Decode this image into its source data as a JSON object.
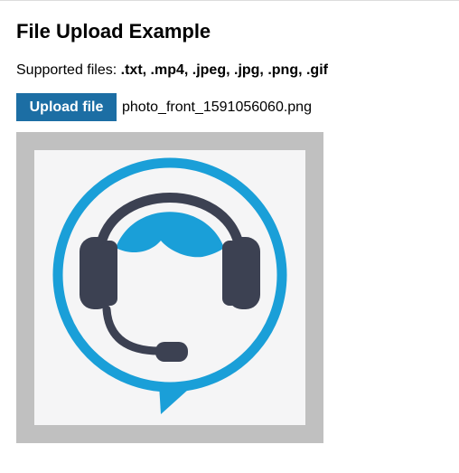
{
  "page": {
    "title": "File Upload Example"
  },
  "supported": {
    "label": "Supported files:",
    "types": ".txt, .mp4, .jpeg, .jpg, .png, .gif"
  },
  "upload": {
    "button_label": "Upload file",
    "file_name": "photo_front_1591056060.png"
  },
  "preview": {
    "icon": "headset-support-icon",
    "colors": {
      "frame": "#c0c0c0",
      "image_bg": "#f5f5f6",
      "ring": "#1a9fd8",
      "headset": "#3c4152"
    }
  },
  "colors": {
    "button_bg": "#1c6ea4",
    "button_text": "#ffffff"
  }
}
